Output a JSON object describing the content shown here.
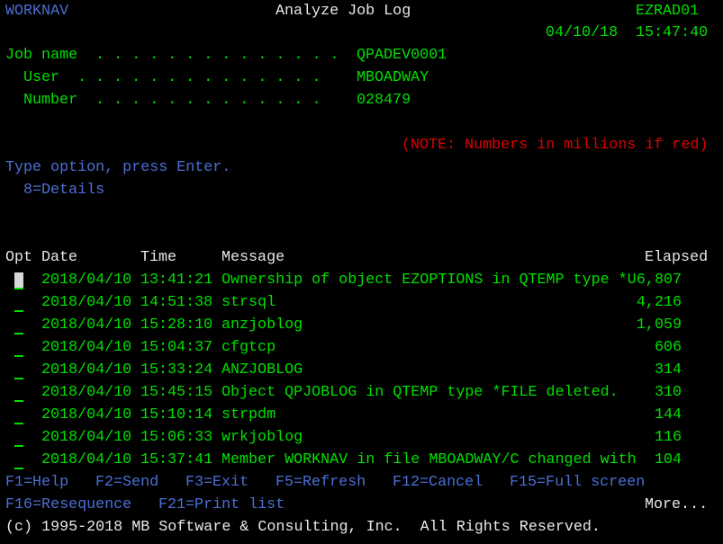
{
  "header": {
    "system_name": "WORKNAV",
    "screen_title": "Analyze Job Log",
    "device": "EZRAD01",
    "date": "04/10/18",
    "time": "15:47:40"
  },
  "job_info": {
    "job_name_label": "Job name  . . . . . . . . . . . . . .",
    "job_name_value": "QPADEV0001",
    "user_label": "User  . . . . . . . . . . . . . .",
    "user_value": "MBOADWAY",
    "number_label": "Number  . . . . . . . . . . . . .",
    "number_value": "028479"
  },
  "note": "(NOTE: Numbers in millions if red)",
  "instructions": {
    "prompt": "Type option, press Enter.",
    "options": "8=Details"
  },
  "table": {
    "columns": {
      "opt": "Opt",
      "date": "Date",
      "time": "Time",
      "message": "Message",
      "elapsed": "Elapsed"
    },
    "rows": [
      {
        "opt": "",
        "date": "2018/04/10",
        "time": "13:41:21",
        "message": "Ownership of object EZOPTIONS in QTEMP type *U",
        "elapsed": "6,807"
      },
      {
        "opt": "",
        "date": "2018/04/10",
        "time": "14:51:38",
        "message": "strsql",
        "elapsed": "4,216"
      },
      {
        "opt": "",
        "date": "2018/04/10",
        "time": "15:28:10",
        "message": "anzjoblog",
        "elapsed": "1,059"
      },
      {
        "opt": "",
        "date": "2018/04/10",
        "time": "15:04:37",
        "message": "cfgtcp",
        "elapsed": "606"
      },
      {
        "opt": "",
        "date": "2018/04/10",
        "time": "15:33:24",
        "message": "ANZJOBLOG",
        "elapsed": "314"
      },
      {
        "opt": "",
        "date": "2018/04/10",
        "time": "15:45:15",
        "message": "Object QPJOBLOG in QTEMP type *FILE deleted.",
        "elapsed": "310"
      },
      {
        "opt": "",
        "date": "2018/04/10",
        "time": "15:10:14",
        "message": "strpdm",
        "elapsed": "144"
      },
      {
        "opt": "",
        "date": "2018/04/10",
        "time": "15:06:33",
        "message": "wrkjoblog",
        "elapsed": "116"
      },
      {
        "opt": "",
        "date": "2018/04/10",
        "time": "15:37:41",
        "message": "Member WORKNAV in file MBOADWAY/C changed with",
        "elapsed": "104"
      }
    ]
  },
  "function_keys": {
    "line1": [
      "F1=Help",
      "F2=Send",
      "F3=Exit",
      "F5=Refresh",
      "F12=Cancel",
      "F15=Full screen"
    ],
    "line2": [
      "F16=Resequence",
      "F21=Print list"
    ]
  },
  "more_indicator": "More...",
  "copyright": "(c) 1995-2018 MB Software & Consulting, Inc.  All Rights Reserved.",
  "colors": {
    "background": "#000000",
    "field_text": "#00e000",
    "info_text": "#4b6fd6",
    "heading_text": "#e8e8e8",
    "warning_text": "#e00000"
  }
}
